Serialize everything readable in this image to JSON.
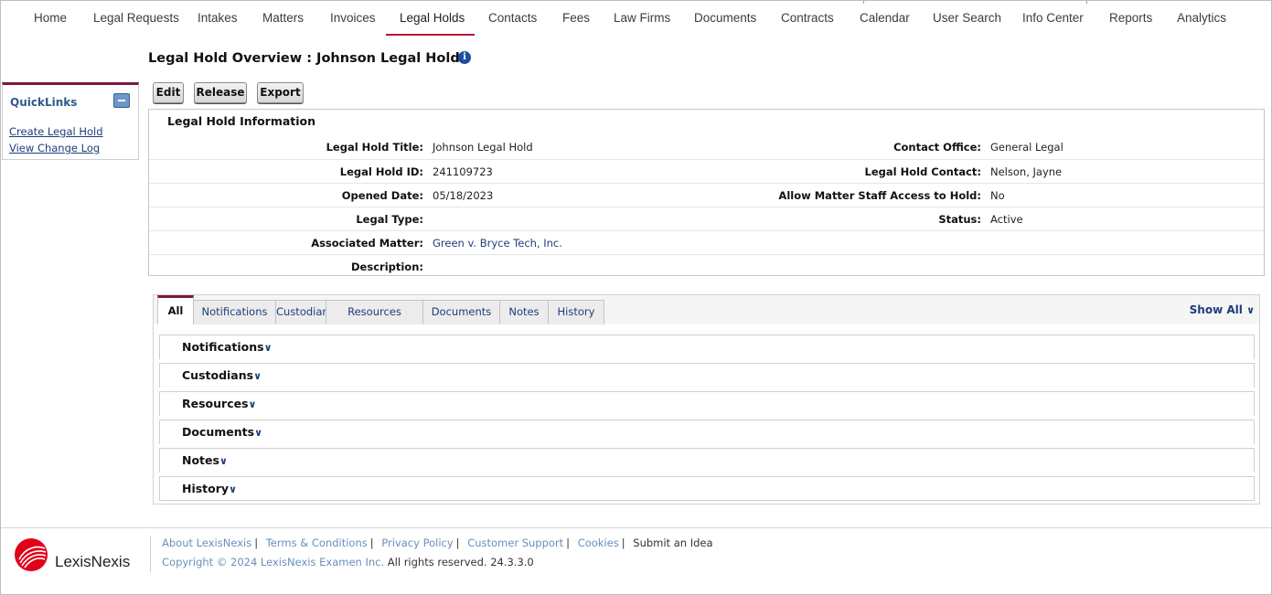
{
  "nav": {
    "items": [
      "Home",
      "Legal Requests",
      "Intakes",
      "Matters",
      "Invoices",
      "Legal Holds",
      "Contacts",
      "Fees",
      "Law Firms",
      "Documents",
      "Contracts",
      "Calendar",
      "User Search",
      "Info Center",
      "Reports",
      "Analytics"
    ],
    "active": "Legal Holds",
    "accent_color": "#b3153a"
  },
  "quicklinks": {
    "title": "QuickLinks",
    "collapse_icon": "minus-icon",
    "links": [
      "Create Legal Hold",
      "View Change Log"
    ]
  },
  "page": {
    "title": "Legal Hold Overview : Johnson Legal Hold",
    "info_icon": "info-icon",
    "buttons": [
      "Edit",
      "Release",
      "Export"
    ]
  },
  "info": {
    "heading": "Legal Hold Information",
    "left_fields": [
      {
        "label": "Legal Hold Title:",
        "value": "Johnson Legal Hold"
      },
      {
        "label": "Legal Hold ID:",
        "value": "241109723"
      },
      {
        "label": "Opened Date:",
        "value": "05/18/2023"
      },
      {
        "label": "Legal Type:",
        "value": ""
      },
      {
        "label": "Associated Matter:",
        "value": "Green v. Bryce Tech, Inc."
      },
      {
        "label": "Description:",
        "value": ""
      }
    ],
    "right_fields": [
      {
        "label": "Contact Office:",
        "value": "General Legal"
      },
      {
        "label": "Legal Hold Contact:",
        "value": "Nelson, Jayne"
      },
      {
        "label": "Allow Matter Staff Access to Hold:",
        "value": "No"
      },
      {
        "label": "Status:",
        "value": "Active"
      }
    ]
  },
  "tabs": {
    "items": [
      "All",
      "Notifications",
      "Custodians",
      "Resources",
      "Documents",
      "Notes",
      "History"
    ],
    "active": "All",
    "show_all": "Show All"
  },
  "sections": [
    "Notifications",
    "Custodians",
    "Resources",
    "Documents",
    "Notes",
    "History"
  ],
  "footer": {
    "logo_text": "LexisNexis",
    "logo_color": "#e1001a",
    "links": [
      "About LexisNexis",
      "Terms & Conditions",
      "Privacy Policy",
      "Customer Support",
      "Cookies",
      "Submit an Idea"
    ],
    "copyright": "Copyright © 2024 LexisNexis Examen Inc.",
    "rights": "All rights reserved. 24.3.3.0"
  }
}
